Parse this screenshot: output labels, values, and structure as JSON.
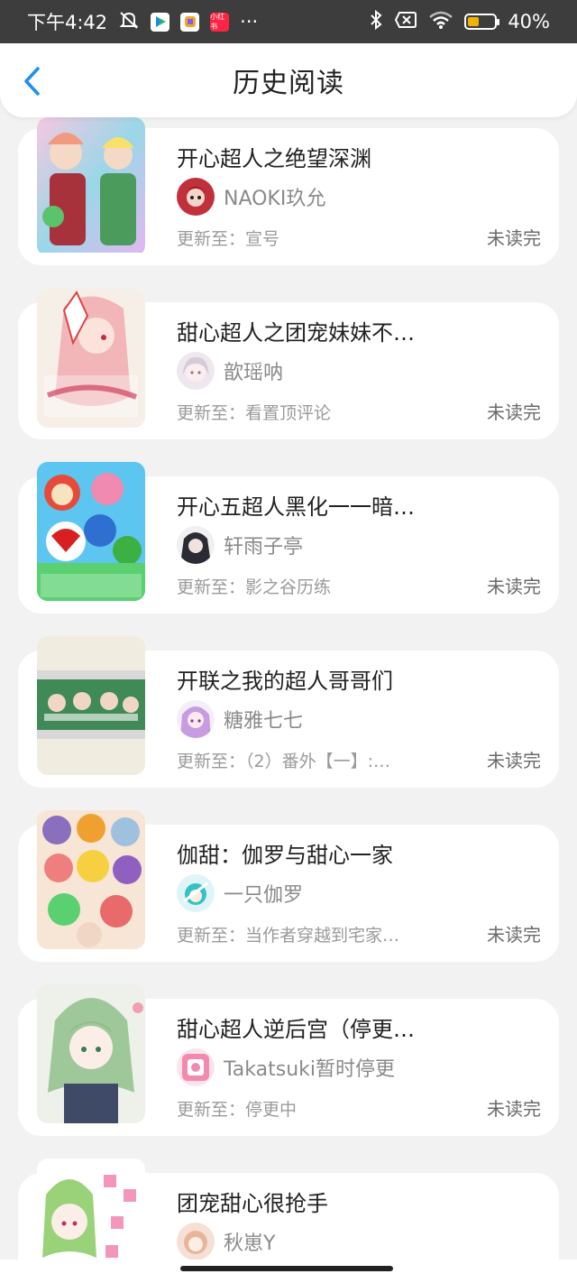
{
  "status_bar": {
    "time": "下午4:42",
    "dots": "···",
    "battery": "40%",
    "battery_level": 0.4,
    "icons": [
      "mute-icon",
      "play-store-icon",
      "app-icon",
      "xiaohongshu-icon",
      "bluetooth-icon",
      "sim-icon",
      "wifi-icon",
      "battery-icon"
    ],
    "app_icon_label": "小红书"
  },
  "header": {
    "title": "历史阅读",
    "back_icon": "chevron-left-icon"
  },
  "colors": {
    "accent": "#1e8ef0",
    "background": "#f2f2f2",
    "card": "#ffffff"
  },
  "items": [
    {
      "title": "开心超人之绝望深渊",
      "author": "NAOKI玖允",
      "update_label": "更新至：",
      "update": "宣号",
      "status": "未读完"
    },
    {
      "title": "甜心超人之团宠妹妹不…",
      "author": "歆瑶呐",
      "update_label": "更新至：",
      "update": "看置顶评论",
      "status": "未读完"
    },
    {
      "title": "开心五超人黑化一一暗…",
      "author": "轩雨子亭",
      "update_label": "更新至：",
      "update": "影之谷历练",
      "status": "未读完"
    },
    {
      "title": "开联之我的超人哥哥们",
      "author": "糖雅七七",
      "update_label": "更新至：",
      "update": "（2）番外【一】:…",
      "status": "未读完"
    },
    {
      "title": "伽甜：伽罗与甜心一家",
      "author": "一只伽罗",
      "update_label": "更新至：",
      "update": "当作者穿越到宅家…",
      "status": "未读完"
    },
    {
      "title": "甜心超人逆后宫（停更…",
      "author": "Takatsuki暂时停更",
      "update_label": "更新至：",
      "update": "停更中",
      "status": "未读完"
    },
    {
      "title": "团宠甜心很抢手",
      "author": "秋崽Y",
      "update_label": "",
      "update": "",
      "status": ""
    }
  ]
}
